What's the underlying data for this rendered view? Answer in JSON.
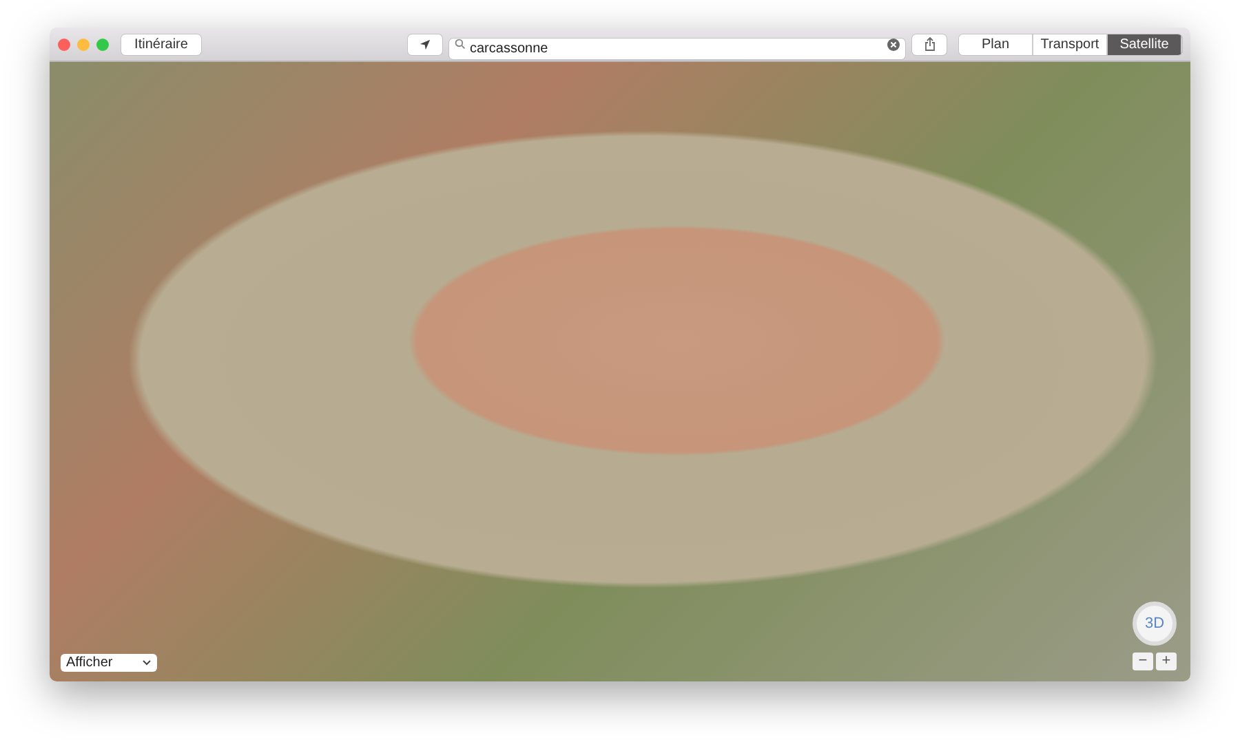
{
  "toolbar": {
    "directions_button": "Itinéraire",
    "search": {
      "value": "carcassonne"
    },
    "view_tabs": [
      {
        "label": "Plan",
        "selected": false
      },
      {
        "label": "Transport",
        "selected": false
      },
      {
        "label": "Satellite",
        "selected": true
      }
    ]
  },
  "map": {
    "show_menu": "Afficher",
    "compass_label": "3D",
    "zoom_buttons": [
      "−",
      "+"
    ]
  }
}
